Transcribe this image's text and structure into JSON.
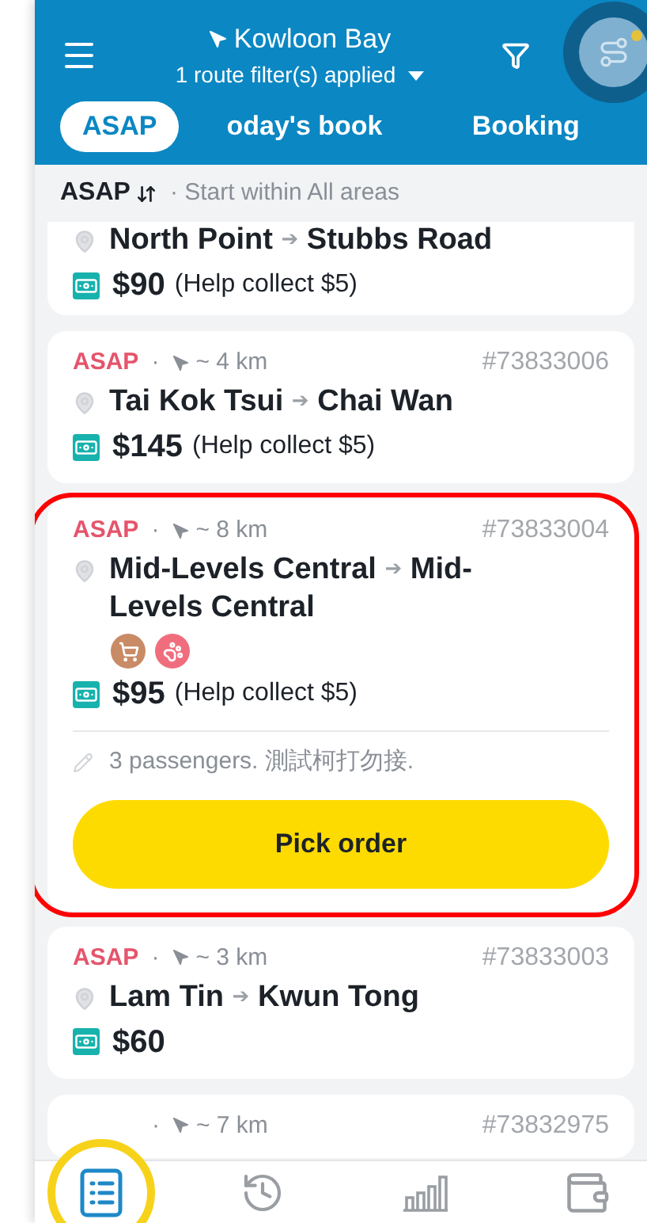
{
  "header": {
    "location": "Kowloon Bay",
    "filter_summary": "1 route filter(s) applied",
    "route_filter_pressed": true
  },
  "tabs": [
    {
      "label": "ASAP",
      "selected": true
    },
    {
      "label": "oday's book",
      "selected": false
    },
    {
      "label": "Booking",
      "selected": false
    }
  ],
  "sort_bar": {
    "sort": "ASAP",
    "scope": "· Start within All areas"
  },
  "orders": [
    {
      "from": "North Point",
      "arrow": "➔",
      "to": "Stubbs Road",
      "price": "$90",
      "extra": "(Help collect $5)",
      "highlighted": false
    },
    {
      "tag": "ASAP",
      "separator": "·",
      "distance": "~ 4 km",
      "id": "#73833006",
      "from": "Tai Kok Tsui",
      "arrow": "➔",
      "to": "Chai Wan",
      "price": "$145",
      "extra": "(Help collect $5)",
      "highlighted": false
    },
    {
      "tag": "ASAP",
      "separator": "·",
      "distance": "~ 8 km",
      "id": "#73833004",
      "from": "Mid-Levels Central",
      "arrow": "➔",
      "to": "Mid-Levels Central",
      "badges": [
        {
          "kind": "cart",
          "color": "#c98a66"
        },
        {
          "kind": "pet",
          "color": "#f06d7e"
        }
      ],
      "price": "$95",
      "extra": "(Help collect $5)",
      "note": "3 passengers. 測試柯打勿接.",
      "action": "Pick order",
      "highlighted": true
    },
    {
      "tag": "ASAP",
      "separator": "·",
      "distance": "~ 3 km",
      "id": "#73833003",
      "from": "Lam Tin",
      "arrow": "➔",
      "to": "Kwun Tong",
      "price": "$60",
      "highlighted": false
    },
    {
      "separator": "·",
      "distance": "~ 7 km",
      "id": "#73832975",
      "highlighted": false
    }
  ],
  "nav": [
    {
      "kind": "orders",
      "selected": true,
      "highlighted": true
    },
    {
      "kind": "history",
      "selected": false,
      "highlighted": false
    },
    {
      "kind": "stats",
      "selected": false,
      "highlighted": false
    },
    {
      "kind": "wallet",
      "selected": false,
      "highlighted": false
    }
  ]
}
